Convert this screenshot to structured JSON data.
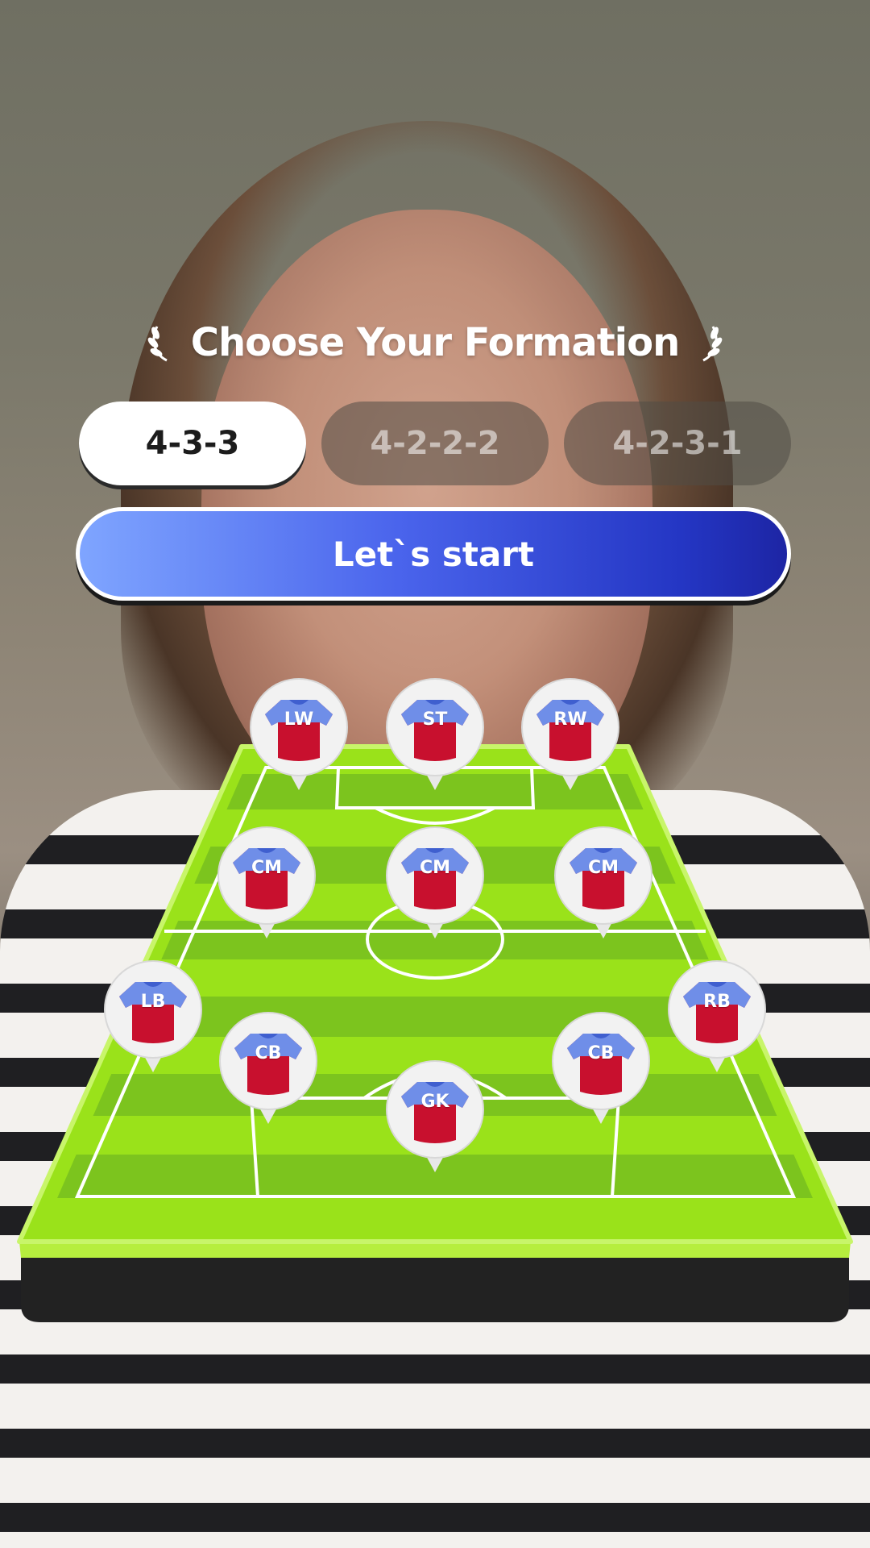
{
  "title": "Choose Your Formation",
  "formations": [
    {
      "label": "4-3-3",
      "selected": true
    },
    {
      "label": "4-2-2-2",
      "selected": false
    },
    {
      "label": "4-2-3-1",
      "selected": false
    }
  ],
  "start_button": "Let`s start",
  "players": [
    {
      "pos": "LW"
    },
    {
      "pos": "ST"
    },
    {
      "pos": "RW"
    },
    {
      "pos": "CM"
    },
    {
      "pos": "CM"
    },
    {
      "pos": "CM"
    },
    {
      "pos": "LB"
    },
    {
      "pos": "RB"
    },
    {
      "pos": "CB"
    },
    {
      "pos": "CB"
    },
    {
      "pos": "GK"
    }
  ],
  "colors": {
    "pitch_light": "#9ae21a",
    "pitch_dark": "#7cc41e",
    "jersey_body": "#c8102e",
    "jersey_sleeve": "#6f8ee8",
    "button_gradient_start": "#7fa5ff",
    "button_gradient_end": "#1d25a4"
  }
}
